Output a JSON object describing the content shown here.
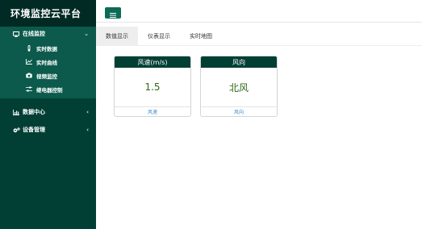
{
  "app": {
    "title": "环境监控云平台"
  },
  "sidebar": {
    "groups": [
      {
        "label": "在线监控",
        "icon": "monitor-icon",
        "expanded": true,
        "items": [
          {
            "label": "实时数据",
            "icon": "thermometer-icon"
          },
          {
            "label": "实时曲线",
            "icon": "line-chart-icon"
          },
          {
            "label": "视频监控",
            "icon": "camera-icon"
          },
          {
            "label": "继电器控制",
            "icon": "sliders-icon"
          }
        ]
      },
      {
        "label": "数据中心",
        "icon": "bar-chart-icon",
        "expanded": false
      },
      {
        "label": "设备管理",
        "icon": "gears-icon",
        "expanded": false
      }
    ]
  },
  "topbar": {
    "menu_icon": "hamburger-icon"
  },
  "tabs": [
    {
      "label": "数值显示",
      "active": true
    },
    {
      "label": "仪表显示",
      "active": false
    },
    {
      "label": "实时地图",
      "active": false
    }
  ],
  "cards": [
    {
      "title": "风速(m/s)",
      "value": "1.5",
      "footer": "风速"
    },
    {
      "title": "风向",
      "value": "北风",
      "footer": "风向"
    }
  ],
  "colors": {
    "sidebar_bg": "#013f35",
    "accent": "#0c6b57",
    "value_text": "#2e6b12",
    "footer_text": "#3a8acb"
  }
}
